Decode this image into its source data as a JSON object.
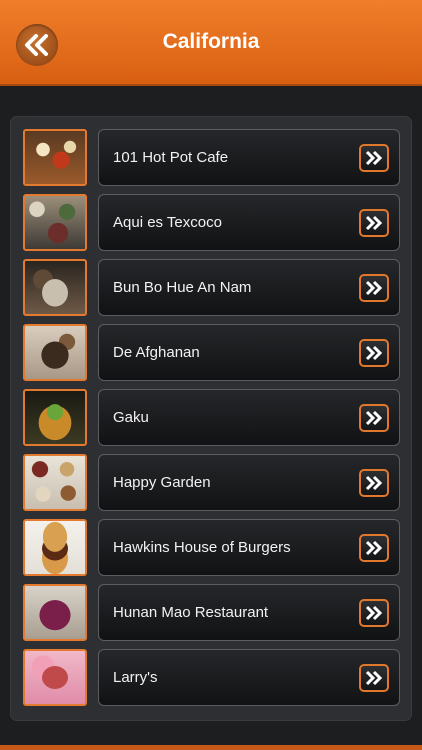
{
  "header": {
    "title": "California",
    "back_icon": "double-chevron-left-icon",
    "color": "#e86f1e"
  },
  "list": {
    "arrow_icon": "double-chevron-right-icon",
    "accent": "#e47a2f",
    "items": [
      {
        "label": "101 Hot Pot Cafe"
      },
      {
        "label": "Aqui es Texcoco"
      },
      {
        "label": "Bun Bo Hue An Nam"
      },
      {
        "label": "De Afghanan"
      },
      {
        "label": "Gaku"
      },
      {
        "label": "Happy Garden"
      },
      {
        "label": "Hawkins House of Burgers"
      },
      {
        "label": "Hunan Mao Restaurant"
      },
      {
        "label": "Larry's"
      }
    ]
  }
}
